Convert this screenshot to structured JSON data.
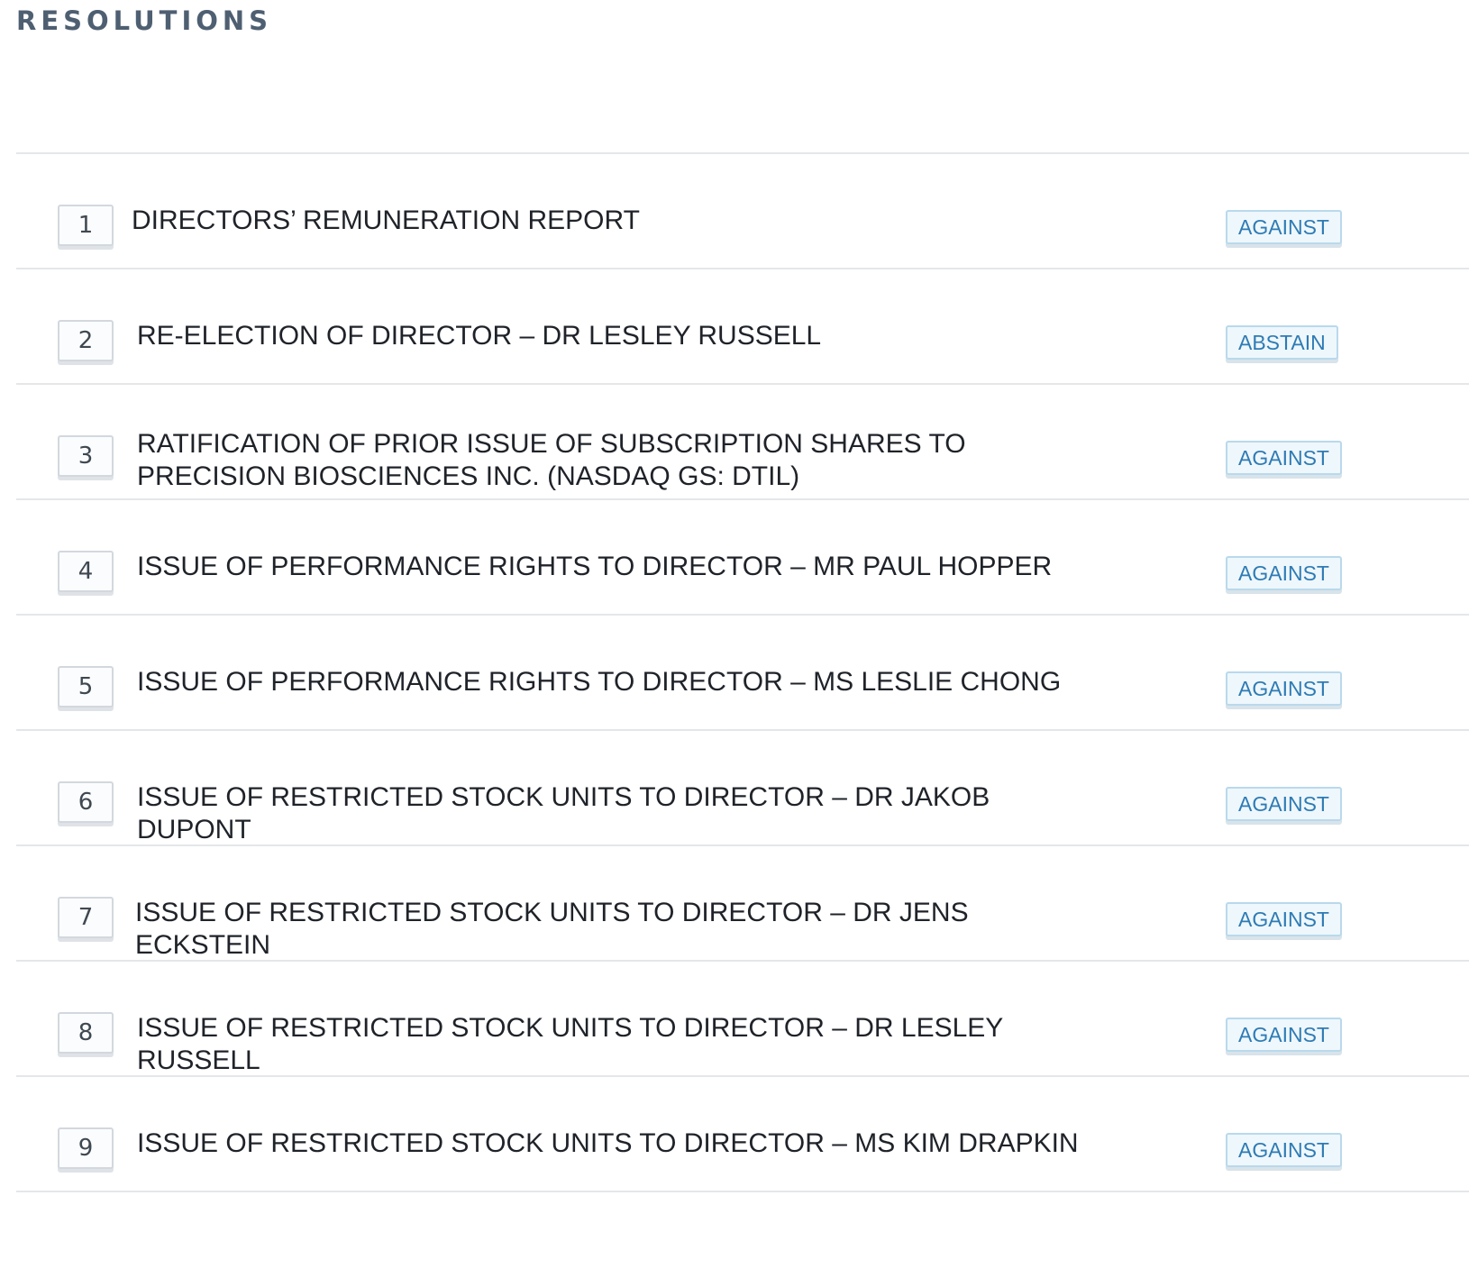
{
  "section": {
    "title": "RESOLUTIONS"
  },
  "resolutions": [
    {
      "number": "1",
      "text": "DIRECTORS’ REMUNERATION REPORT",
      "vote": "AGAINST"
    },
    {
      "number": "2",
      "text": "RE-ELECTION OF DIRECTOR – DR LESLEY RUSSELL",
      "vote": "ABSTAIN"
    },
    {
      "number": "3",
      "text": "RATIFICATION OF PRIOR ISSUE OF SUBSCRIPTION SHARES TO PRECISION BIOSCIENCES INC. (NASDAQ GS: DTIL)",
      "vote": "AGAINST"
    },
    {
      "number": "4",
      "text": "ISSUE OF PERFORMANCE RIGHTS TO DIRECTOR – MR PAUL HOPPER",
      "vote": "AGAINST"
    },
    {
      "number": "5",
      "text": "ISSUE OF PERFORMANCE RIGHTS TO DIRECTOR – MS LESLIE CHONG",
      "vote": "AGAINST"
    },
    {
      "number": "6",
      "text": "ISSUE OF RESTRICTED STOCK UNITS TO DIRECTOR – DR JAKOB DUPONT",
      "vote": "AGAINST"
    },
    {
      "number": "7",
      "text": "ISSUE OF RESTRICTED STOCK UNITS TO DIRECTOR – DR JENS ECKSTEIN",
      "vote": "AGAINST"
    },
    {
      "number": "8",
      "text": "ISSUE OF RESTRICTED STOCK UNITS TO DIRECTOR – DR LESLEY RUSSELL",
      "vote": "AGAINST"
    },
    {
      "number": "9",
      "text": "ISSUE OF RESTRICTED STOCK UNITS TO DIRECTOR – MS KIM DRAPKIN",
      "vote": "AGAINST"
    }
  ],
  "colors": {
    "title": "#4f5f72",
    "divider": "#e4e7ea",
    "vote_text": "#2e7bb4",
    "vote_border": "#b9d9ec",
    "vote_background": "#eef7fc"
  }
}
